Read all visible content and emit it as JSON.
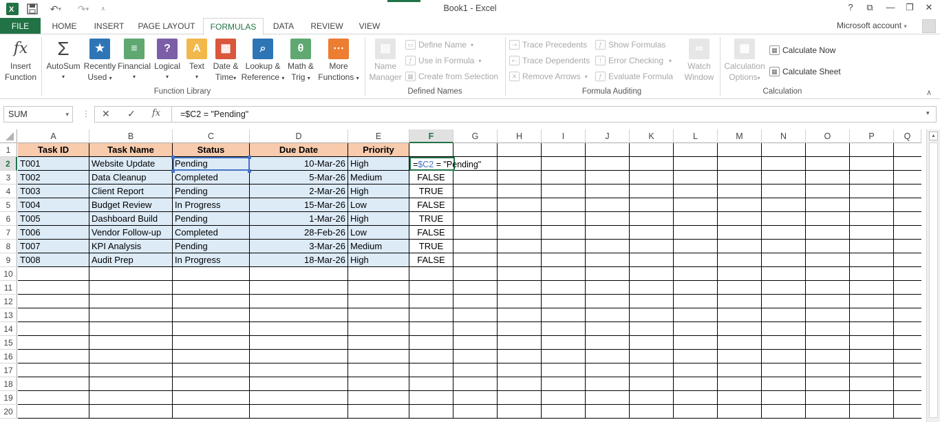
{
  "window": {
    "title": "Book1 - Excel",
    "account": "Microsoft account"
  },
  "tabs": [
    "FILE",
    "HOME",
    "INSERT",
    "PAGE LAYOUT",
    "FORMULAS",
    "DATA",
    "REVIEW",
    "VIEW"
  ],
  "ribbon": {
    "insert_function": [
      "Insert",
      "Function"
    ],
    "autosum": "AutoSum",
    "recently_used": [
      "Recently",
      "Used"
    ],
    "financial": "Financial",
    "logical": "Logical",
    "text": "Text",
    "date_time": [
      "Date &",
      "Time"
    ],
    "lookup": [
      "Lookup &",
      "Reference"
    ],
    "math": [
      "Math &",
      "Trig"
    ],
    "more": [
      "More",
      "Functions"
    ],
    "function_library_label": "Function Library",
    "name_manager": [
      "Name",
      "Manager"
    ],
    "define_name": "Define Name",
    "use_in_formula": "Use in Formula",
    "create_from_selection": "Create from Selection",
    "defined_names_label": "Defined Names",
    "trace_precedents": "Trace Precedents",
    "trace_dependents": "Trace Dependents",
    "remove_arrows": "Remove Arrows",
    "show_formulas": "Show Formulas",
    "error_checking": "Error Checking",
    "evaluate_formula": "Evaluate Formula",
    "formula_auditing_label": "Formula Auditing",
    "watch_window": [
      "Watch",
      "Window"
    ],
    "calc_options": [
      "Calculation",
      "Options"
    ],
    "calc_now": "Calculate Now",
    "calc_sheet": "Calculate Sheet",
    "calculation_label": "Calculation"
  },
  "formula_bar": {
    "name_box": "SUM",
    "fx": "fx",
    "formula": "=$C2 = \"Pending\""
  },
  "columns": [
    "A",
    "B",
    "C",
    "D",
    "E",
    "F",
    "G",
    "H",
    "I",
    "J",
    "K",
    "L",
    "M",
    "N",
    "O",
    "P",
    "Q"
  ],
  "rows": [
    "1",
    "2",
    "3",
    "4",
    "5",
    "6",
    "7",
    "8",
    "9",
    "10",
    "11",
    "12",
    "13",
    "14",
    "15",
    "16",
    "17",
    "18",
    "19",
    "20"
  ],
  "table": {
    "headers": [
      "Task ID",
      "Task Name",
      "Status",
      "Due Date",
      "Priority"
    ],
    "rows": [
      [
        "T001",
        "Website Update",
        "Pending",
        "10-Mar-26",
        "High",
        ""
      ],
      [
        "T002",
        "Data Cleanup",
        "Completed",
        "5-Mar-26",
        "Medium",
        "FALSE"
      ],
      [
        "T003",
        "Client Report",
        "Pending",
        "2-Mar-26",
        "High",
        "TRUE"
      ],
      [
        "T004",
        "Budget Review",
        "In Progress",
        "15-Mar-26",
        "Low",
        "FALSE"
      ],
      [
        "T005",
        "Dashboard Build",
        "Pending",
        "1-Mar-26",
        "High",
        "TRUE"
      ],
      [
        "T006",
        "Vendor Follow-up",
        "Completed",
        "28-Feb-26",
        "Low",
        "FALSE"
      ],
      [
        "T007",
        "KPI Analysis",
        "Pending",
        "3-Mar-26",
        "Medium",
        "TRUE"
      ],
      [
        "T008",
        "Audit Prep",
        "In Progress",
        "18-Mar-26",
        "High",
        "FALSE"
      ]
    ]
  },
  "editing_cell": {
    "prefix": "=",
    "ref": "$C2",
    "suffix": " = \"Pending\""
  },
  "colors": {
    "excel_green": "#217346",
    "header_fill": "#f8cbad",
    "data_fill": "#ddebf7",
    "ref_blue": "#4472c4"
  }
}
